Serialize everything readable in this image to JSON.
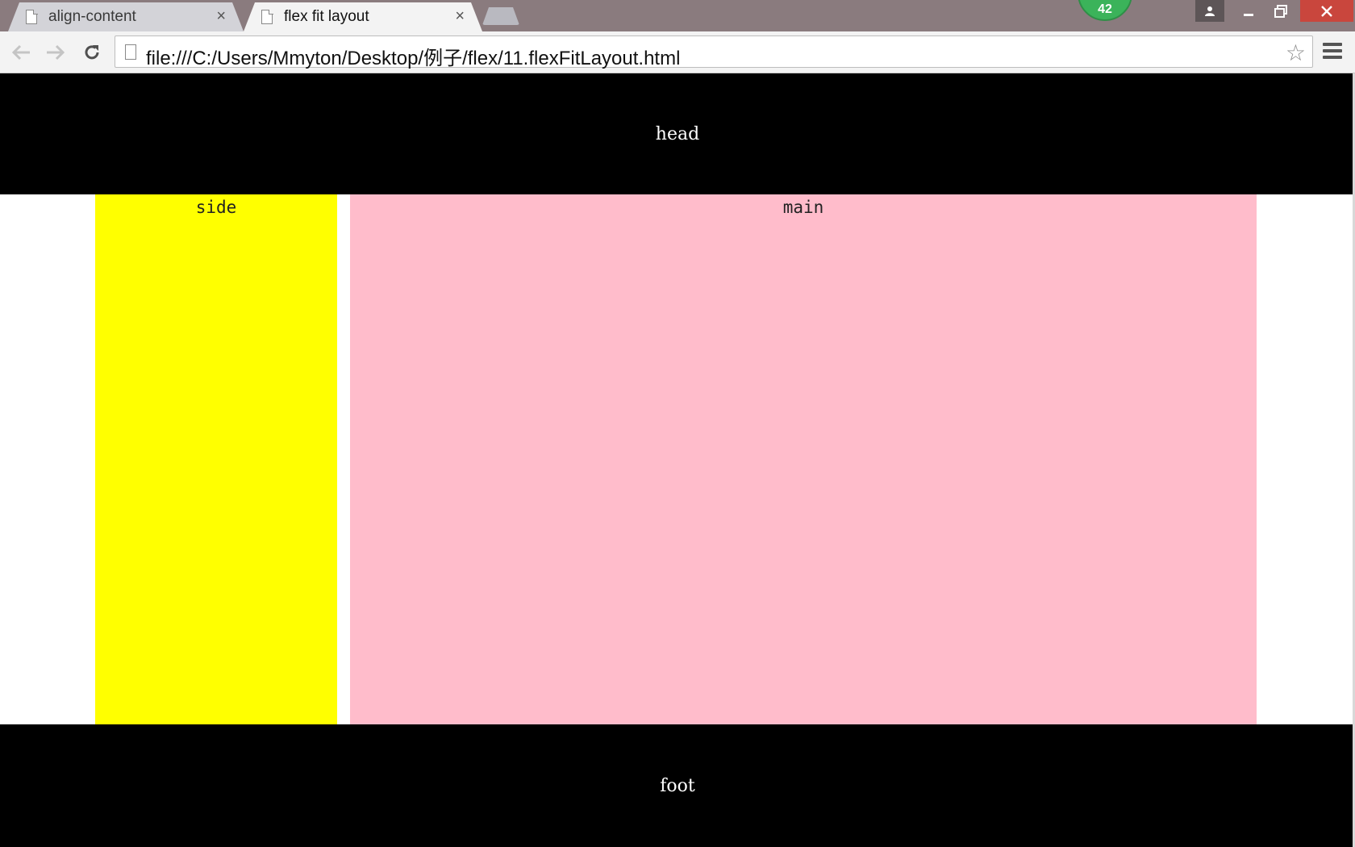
{
  "browser": {
    "tabs": [
      {
        "title": "align-content",
        "active": false,
        "close": "×"
      },
      {
        "title": "flex fit layout",
        "active": true,
        "close": "×"
      }
    ],
    "badge_count": "42",
    "address": "file:///C:/Users/Mmyton/Desktop/例子/flex/11.flexFitLayout.html",
    "icons": {
      "back": "arrow-left-icon",
      "forward": "arrow-right-icon",
      "reload": "reload-icon",
      "star": "star-icon",
      "menu": "hamburger-menu-icon",
      "profile": "person-icon",
      "minimize": "minimize-icon",
      "maximize": "maximize-icon",
      "close": "close-icon"
    },
    "colors": {
      "titlebar": "#8a7b7e",
      "close_button": "#c9463d",
      "badge": "#3bb35a"
    }
  },
  "page": {
    "head_text": "head",
    "side_text": "side",
    "main_text": "main",
    "foot_text": "foot",
    "colors": {
      "head": "#000000",
      "side": "#ffff00",
      "main": "#ffbccb",
      "foot": "#000000"
    }
  }
}
